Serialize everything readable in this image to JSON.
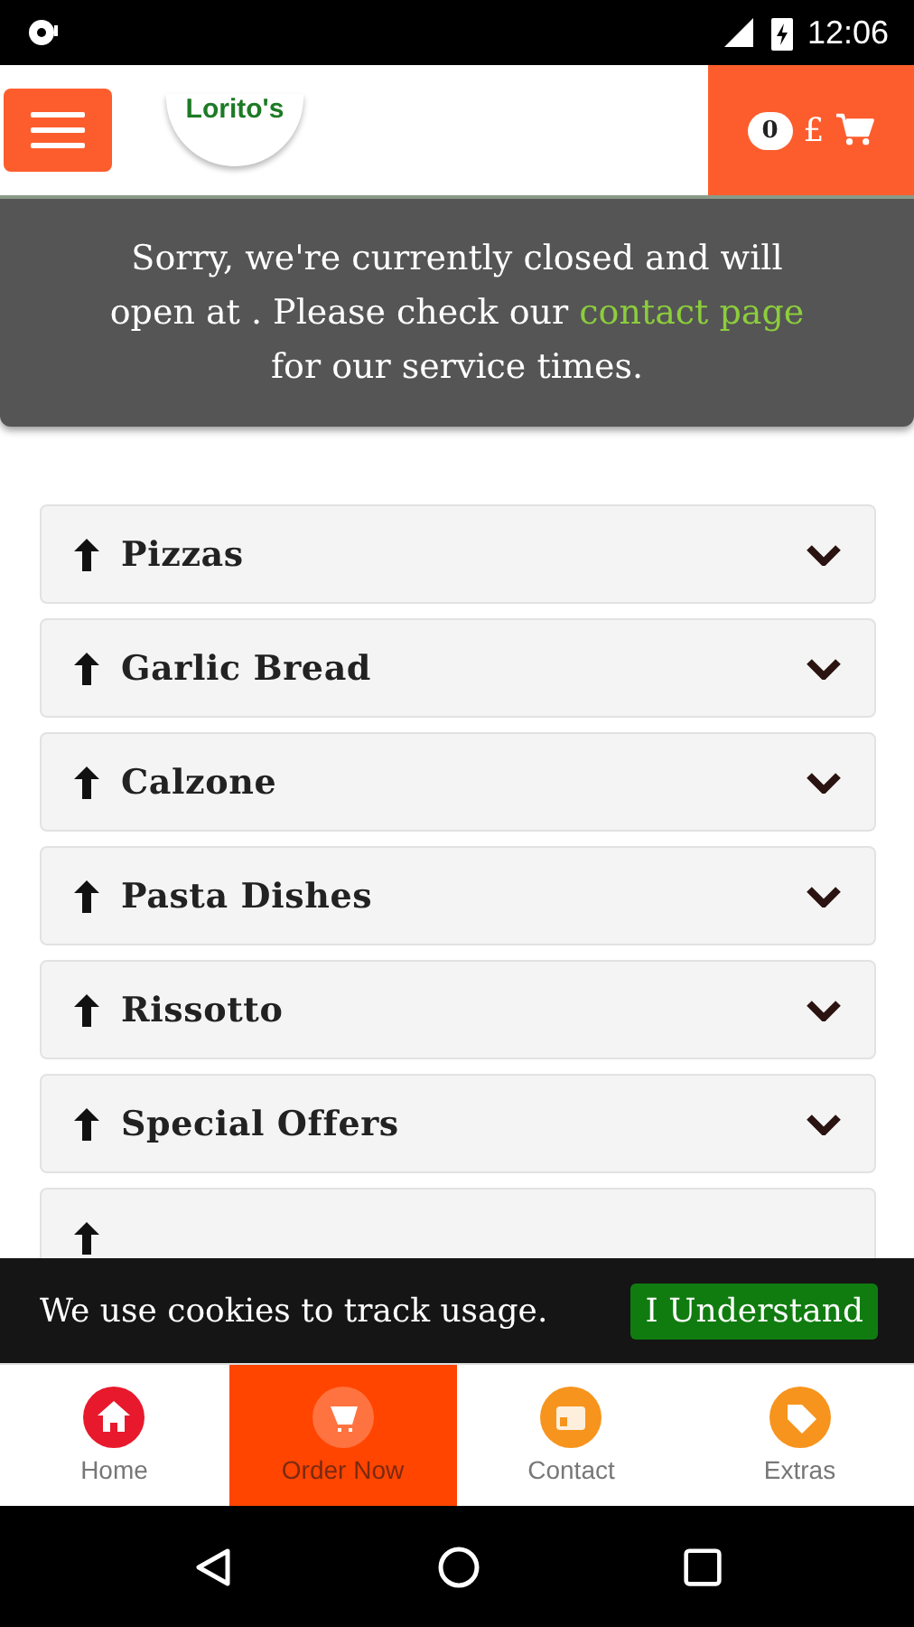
{
  "status_bar": {
    "time": "12:06"
  },
  "header": {
    "logo": "Lorito's",
    "cart_count": "0",
    "currency": "£"
  },
  "notice": {
    "before": "Sorry, we're currently closed and will open at . Please check our",
    "link": "contact page",
    "after": "for our service times."
  },
  "categories": [
    {
      "name": "Pizzas",
      "expanded": false
    },
    {
      "name": "Garlic Bread",
      "expanded": false
    },
    {
      "name": "Calzone",
      "expanded": false
    },
    {
      "name": "Pasta Dishes",
      "expanded": false
    },
    {
      "name": "Rissotto",
      "expanded": false
    },
    {
      "name": "Special Offers",
      "expanded": false
    }
  ],
  "cookie_bar": {
    "message": "We use cookies to track usage.",
    "button": "I Understand"
  },
  "tabs": [
    {
      "label": "Home",
      "kind": "home",
      "selected": false
    },
    {
      "label": "Order Now",
      "kind": "cart",
      "selected": true
    },
    {
      "label": "Contact",
      "kind": "contact",
      "selected": false
    },
    {
      "label": "Extras",
      "kind": "tag",
      "selected": false
    }
  ]
}
